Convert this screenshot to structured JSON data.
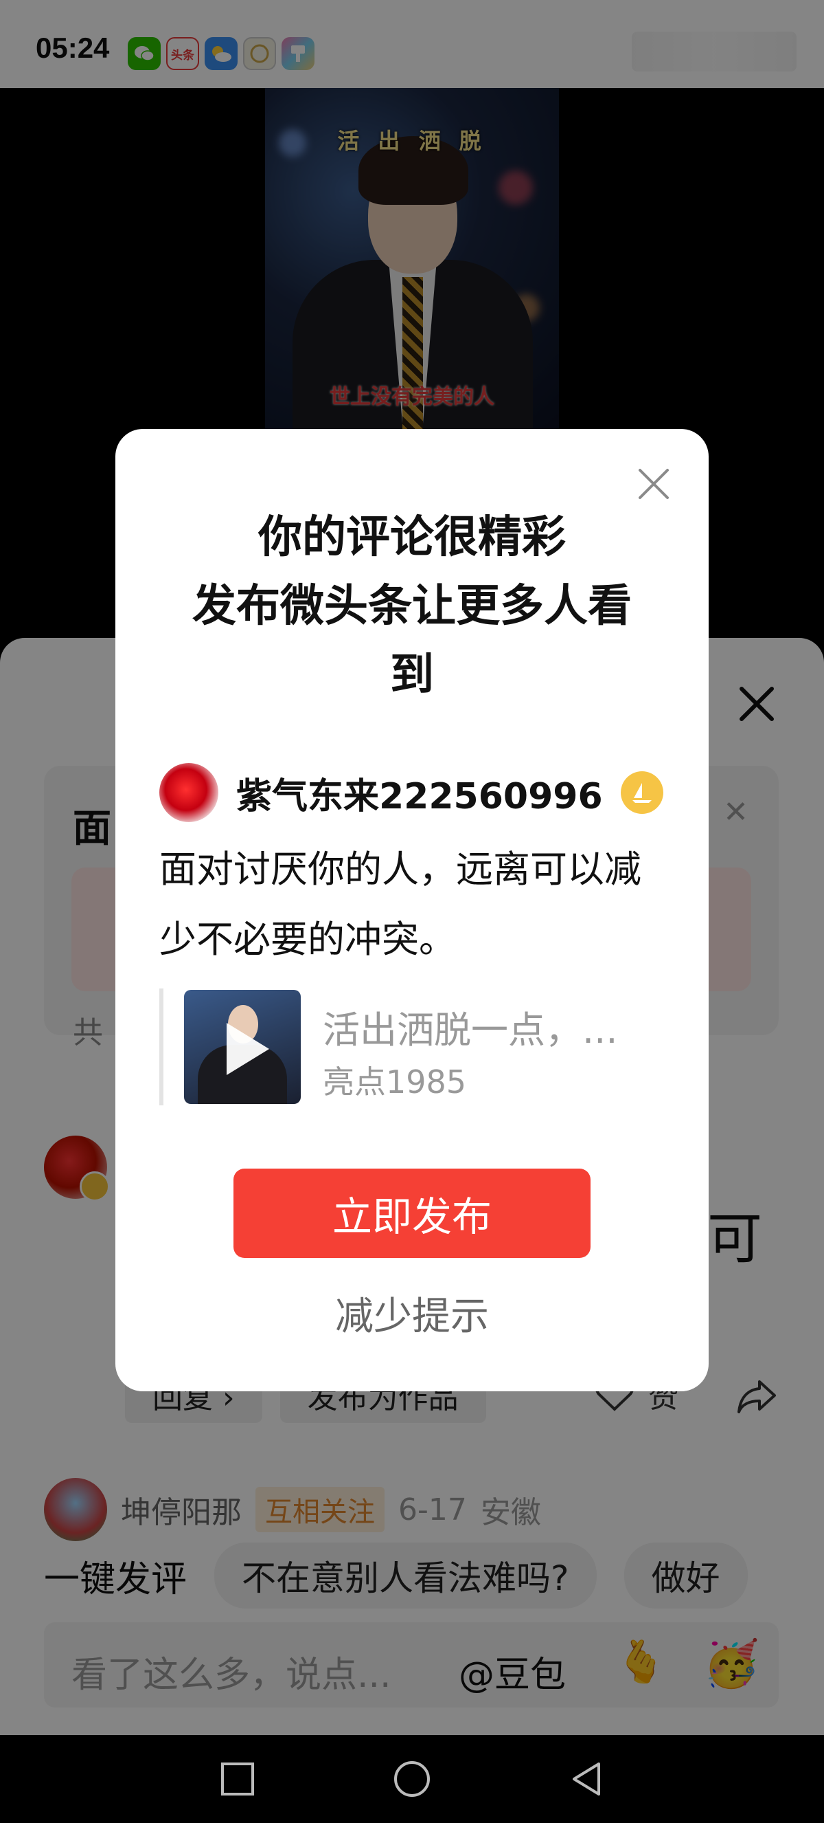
{
  "status_bar": {
    "time": "05:24",
    "apps": [
      {
        "icon": "wechat-icon",
        "color": "#2dc100",
        "label": ""
      },
      {
        "icon": "toutiao-icon",
        "color": "#e83a3a",
        "label": "头条"
      },
      {
        "icon": "weather-icon",
        "color": "#3a8ef0",
        "label": ""
      },
      {
        "icon": "yoyo-icon",
        "color": "#e8e6d4",
        "label": ""
      },
      {
        "icon": "paint-brush-icon",
        "color": "#f07ab0",
        "label": ""
      }
    ]
  },
  "video": {
    "overlay_title": "活 出 洒 脱",
    "caption": "世上没有完美的人"
  },
  "sheet": {
    "card_title": "面",
    "card_footer": "共",
    "comment_tail": "可",
    "actions": {
      "reply": "回复 ›",
      "publish_as_work": "发布为作品",
      "like": "赞"
    },
    "reply_user": {
      "name": "坤停阳那",
      "tag": "互相关注",
      "date": "6-17",
      "location": "安徽"
    },
    "quick_comment": {
      "label": "一键发评",
      "chips": [
        "不在意别人看法难吗?",
        "做好"
      ]
    },
    "input": {
      "placeholder": "看了这么多，说点...",
      "mention": "@豆包"
    }
  },
  "dialog": {
    "title": "你的评论很精彩\n发布微头条让更多人看\n到",
    "username": "紫气东来222560996",
    "comment": "面对讨厌你的人，远离可以减少不必要的冲突。",
    "quote_title": "活出洒脱一点，...",
    "quote_author": "亮点1985",
    "primary_button": "立即发布",
    "secondary_button": "减少提示"
  },
  "colors": {
    "accent": "#f54035",
    "badge_gold": "#f6c445",
    "tag_orange": "#e0872e"
  }
}
